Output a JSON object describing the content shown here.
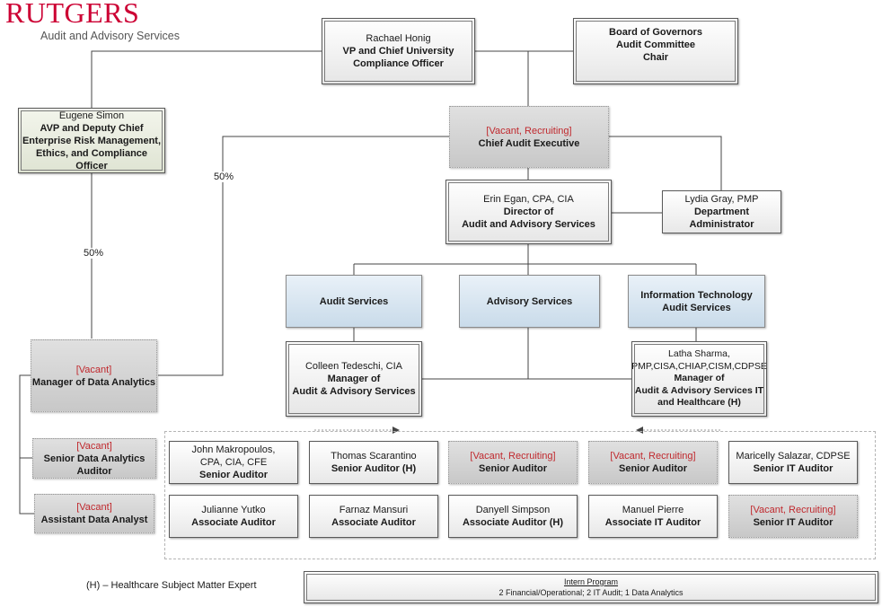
{
  "logo": {
    "main": "Rutgers",
    "sub": "Audit and Advisory Services",
    "color": "#cc0033"
  },
  "colors": {
    "vacant_text": "#c0282d",
    "department_fill": "#c9dbea",
    "deputy_fill": "#dfe4d3",
    "vacant_fill": "#c8c8c8"
  },
  "top": {
    "vp": {
      "name": "Rachael Honig",
      "title_line1": "VP and Chief University",
      "title_line2": "Compliance Officer"
    },
    "board": {
      "line1": "Board of Governors",
      "line2": "Audit Committee",
      "line3": "Chair"
    }
  },
  "deputy": {
    "name": "Eugene Simon",
    "title_line1": "AVP and Deputy Chief",
    "title_line2": "Enterprise Risk Management,",
    "title_line3": "Ethics, and Compliance Officer"
  },
  "cae": {
    "status": "[Vacant, Recruiting]",
    "title": "Chief Audit Executive"
  },
  "director": {
    "name": "Erin Egan, CPA, CIA",
    "title_line1": "Director of",
    "title_line2": "Audit and Advisory Services"
  },
  "admin": {
    "name": "Lydia Gray, PMP",
    "title_line1": "Department",
    "title_line2": "Administrator"
  },
  "percentages": {
    "deputy_link": "50%",
    "cae_link": "50%"
  },
  "departments": [
    {
      "line1": "Audit Services",
      "line2": ""
    },
    {
      "line1": "Advisory Services",
      "line2": ""
    },
    {
      "line1": "Information Technology",
      "line2": "Audit Services"
    }
  ],
  "managers": {
    "audit": {
      "name": "Colleen Tedeschi, CIA",
      "title_line1": "Manager of",
      "title_line2": "Audit & Advisory Services"
    },
    "it": {
      "name_line1": "Latha Sharma,",
      "name_line2": "PMP,CISA,CHIAP,CISM,CDPSE",
      "title_line1": "Manager of",
      "title_line2": "Audit & Advisory Services IT",
      "title_line3": "and Healthcare (H)"
    }
  },
  "data_analytics": {
    "manager": {
      "status": "[Vacant]",
      "title": "Manager of Data Analytics"
    },
    "senior": {
      "status": "[Vacant]",
      "title_line1": "Senior Data Analytics",
      "title_line2": "Auditor"
    },
    "assistant": {
      "status": "[Vacant]",
      "title": "Assistant Data Analyst"
    }
  },
  "staff_row1": [
    {
      "name_line1": "John Makropoulos,",
      "name_line2": "CPA, CIA, CFE",
      "title": "Senior Auditor",
      "vacant": false
    },
    {
      "name_line1": "Thomas Scarantino",
      "name_line2": "",
      "title": "Senior Auditor (H)",
      "vacant": false
    },
    {
      "name_line1": "[Vacant, Recruiting]",
      "name_line2": "",
      "title": "Senior Auditor",
      "vacant": true
    },
    {
      "name_line1": "[Vacant, Recruiting]",
      "name_line2": "",
      "title": "Senior Auditor",
      "vacant": true
    },
    {
      "name_line1": "Maricelly Salazar, CDPSE",
      "name_line2": "",
      "title": "Senior IT Auditor",
      "vacant": false
    }
  ],
  "staff_row2": [
    {
      "name_line1": "Julianne Yutko",
      "title": "Associate Auditor",
      "vacant": false
    },
    {
      "name_line1": "Farnaz Mansuri",
      "title": "Associate Auditor",
      "vacant": false
    },
    {
      "name_line1": "Danyell Simpson",
      "title": "Associate Auditor (H)",
      "vacant": false
    },
    {
      "name_line1": "Manuel Pierre",
      "title": "Associate IT Auditor",
      "vacant": false
    },
    {
      "name_line1": "[Vacant, Recruiting]",
      "title": "Senior IT Auditor",
      "vacant": true
    }
  ],
  "legend": "(H) – Healthcare Subject Matter Expert",
  "intern": {
    "title": "Intern Program",
    "detail": "2 Financial/Operational; 2 IT Audit;  1 Data Analytics"
  }
}
